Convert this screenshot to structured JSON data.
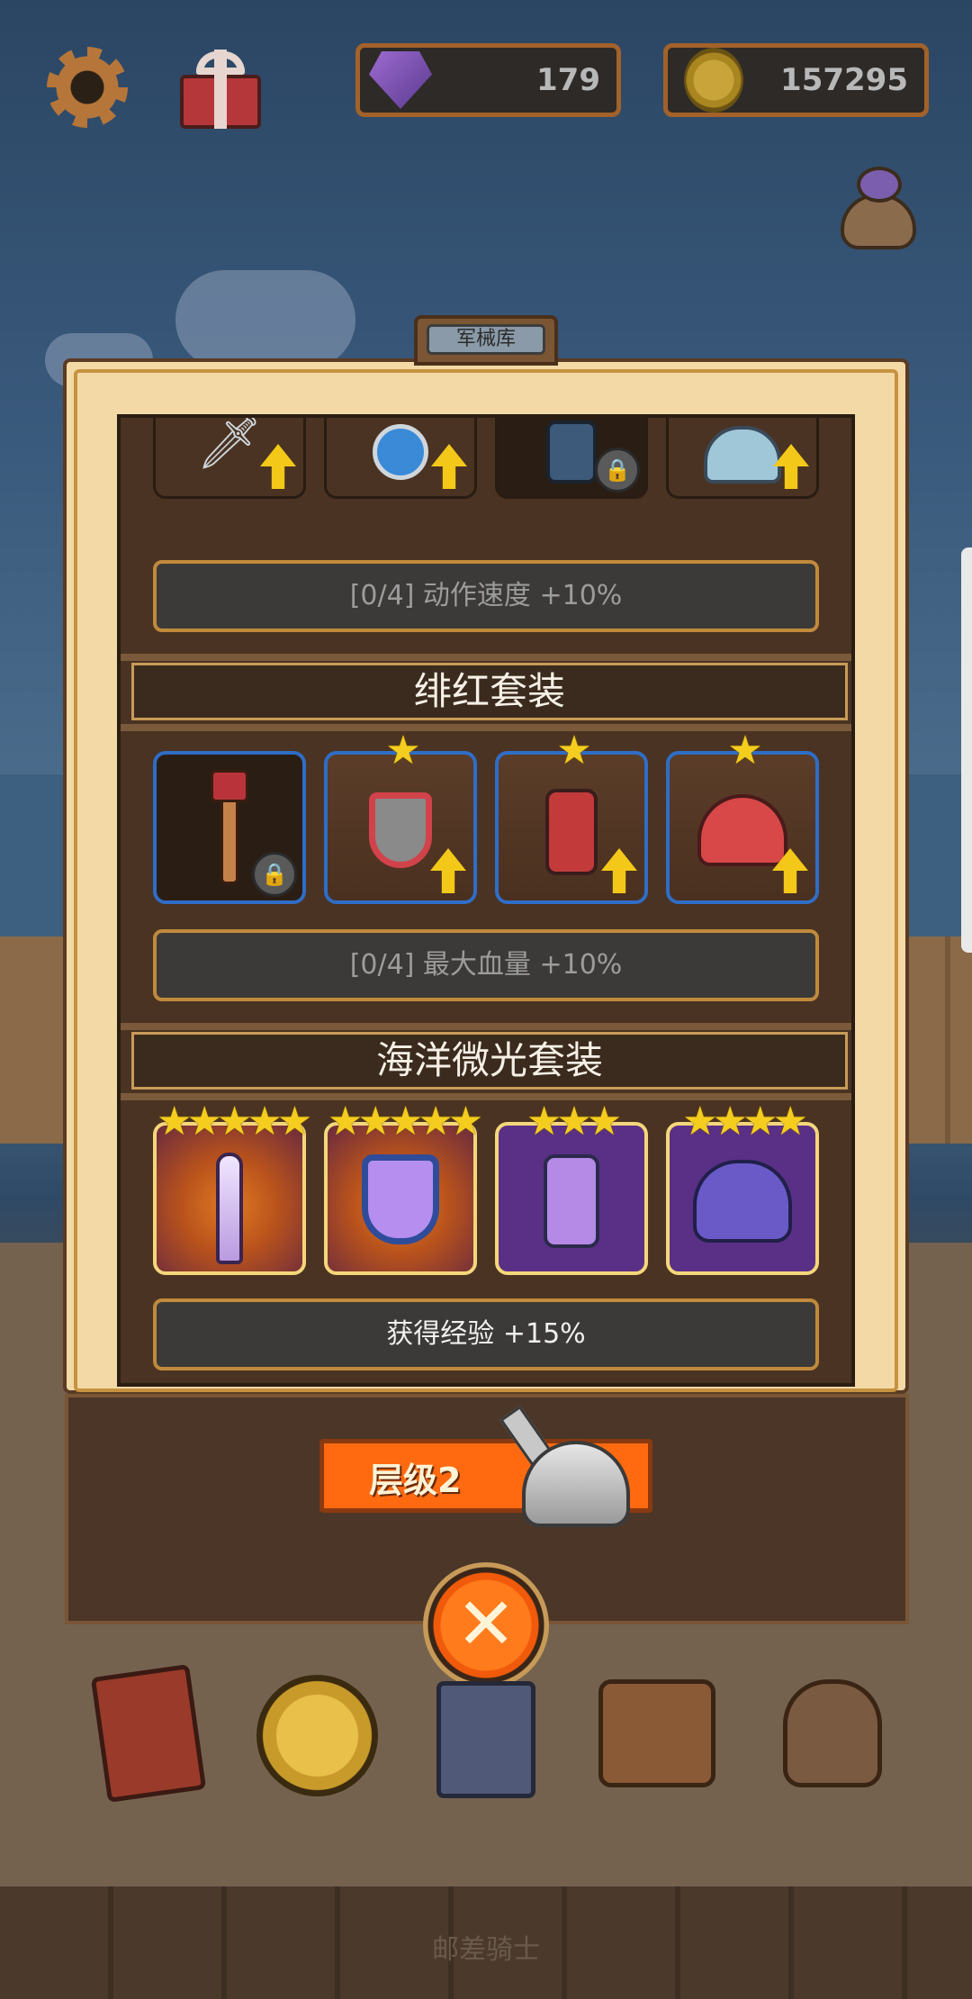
{
  "header": {
    "gems": "179",
    "coins": "157295"
  },
  "dialog": {
    "title": "军械库",
    "set_top": {
      "bonus": "[0/4] 动作速度 +10%"
    },
    "set_crimson": {
      "name": "绯红套装",
      "bonus": "[0/4] 最大血量 +10%"
    },
    "set_ocean": {
      "name": "海洋微光套装",
      "bonus": "获得经验 +15%"
    },
    "level_label": "层级2"
  },
  "footer": {
    "text": "邮差骑士"
  },
  "colors": {
    "accent_orange": "#ff6a10",
    "star": "#f4cd1f",
    "upgrade_arrow": "#f3c818"
  }
}
